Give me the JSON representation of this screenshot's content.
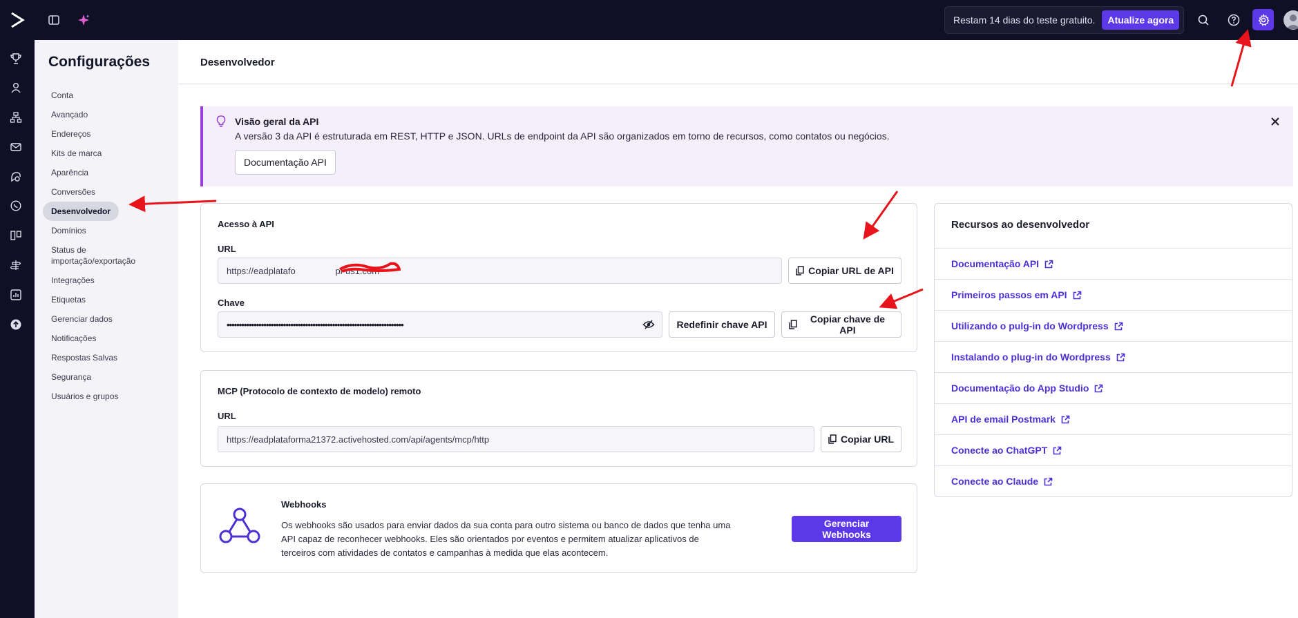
{
  "topbar": {
    "trial_text": "Restam 14 dias do teste gratuito.",
    "upgrade_label": "Atualize agora"
  },
  "sidebar": {
    "title": "Configurações",
    "items": [
      {
        "label": "Conta"
      },
      {
        "label": "Avançado"
      },
      {
        "label": "Endereços"
      },
      {
        "label": "Kits de marca"
      },
      {
        "label": "Aparência"
      },
      {
        "label": "Conversões"
      },
      {
        "label": "Desenvolvedor",
        "active": true
      },
      {
        "label": "Domínios"
      },
      {
        "label": "Status de importação/exportação"
      },
      {
        "label": "Integrações"
      },
      {
        "label": "Etiquetas"
      },
      {
        "label": "Gerenciar dados"
      },
      {
        "label": "Notificações"
      },
      {
        "label": "Respostas Salvas"
      },
      {
        "label": "Segurança"
      },
      {
        "label": "Usuários e grupos"
      }
    ]
  },
  "main": {
    "page_title": "Desenvolvedor",
    "banner": {
      "title": "Visão geral da API",
      "text": "A versão 3 da API é estruturada em REST, HTTP e JSON. URLs de endpoint da API são organizados em torno de recursos, como contatos ou negócios.",
      "button_label": "Documentação API"
    },
    "api_access": {
      "title": "Acesso à API",
      "url_label": "URL",
      "url_value": "https://eadplatafo                pi-us1.com",
      "copy_url_label": "Copiar URL de API",
      "key_label": "Chave",
      "key_value": "••••••••••••••••••••••••••••••••••••••••••••••••••••••••••••••••••••••••",
      "reset_key_label": "Redefinir chave API",
      "copy_key_label": "Copiar chave de API"
    },
    "mcp": {
      "title": "MCP (Protocolo de contexto de modelo) remoto",
      "url_label": "URL",
      "url_value": "https://eadplataforma21372.activehosted.com/api/agents/mcp/http",
      "copy_label": "Copiar URL"
    },
    "webhooks": {
      "title": "Webhooks",
      "text_line1": "Os webhooks são usados para enviar dados da sua conta para outro sistema ou banco de dados que tenha uma",
      "text_line2": "API capaz de reconhecer webhooks. Eles são orientados por eventos e permitem atualizar aplicativos de",
      "text_line3": "terceiros com atividades de contatos e campanhas à medida que elas acontecem.",
      "button_label": "Gerenciar Webhooks"
    },
    "resources": {
      "title": "Recursos ao desenvolvedor",
      "links": [
        {
          "label": "Documentação API"
        },
        {
          "label": "Primeiros passos em API"
        },
        {
          "label": "Utilizando o pulg-in do Wordpress"
        },
        {
          "label": "Instalando o plug-in do Wordpress"
        },
        {
          "label": "Documentação do App Studio"
        },
        {
          "label": "API de email Postmark"
        },
        {
          "label": "Conecte ao ChatGPT"
        },
        {
          "label": "Conecte ao Claude"
        }
      ]
    }
  },
  "colors": {
    "brand": "#5d38e8",
    "nav_bg": "#0f0f26",
    "link": "#4d2fd4",
    "annotation_arrow": "#e8141b"
  }
}
